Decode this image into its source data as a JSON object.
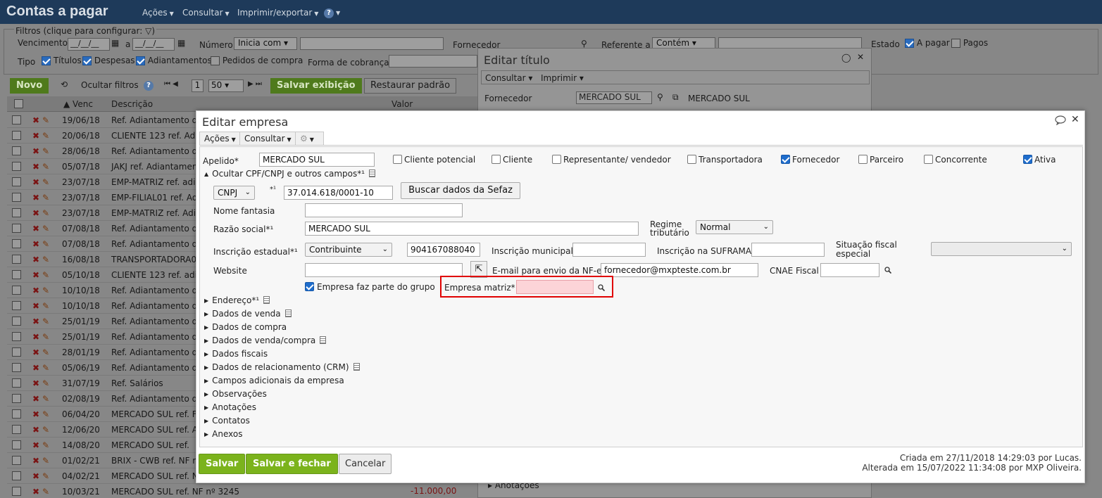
{
  "app": {
    "title": "Contas a pagar",
    "menu": [
      "Ações",
      "Consultar",
      "Imprimir/exportar"
    ]
  },
  "filters": {
    "legend": "Filtros (clique para configurar:",
    "vencimento_label": "Vencimento",
    "date_placeholder": "__/__/__",
    "a_label": "a",
    "numero_label": "Número",
    "numero_mode": "Inicia com",
    "fornecedor_label": "Fornecedor",
    "referente_label": "Referente a",
    "referente_mode": "Contém",
    "estado_label": "Estado",
    "estado_options": [
      {
        "label": "A pagar",
        "checked": true
      },
      {
        "label": "Pagos",
        "checked": false
      }
    ],
    "tipo_label": "Tipo",
    "tipo_options": [
      {
        "label": "Títulos",
        "checked": true
      },
      {
        "label": "Despesas",
        "checked": true
      },
      {
        "label": "Adiantamentos",
        "checked": true
      },
      {
        "label": "Pedidos de compra",
        "checked": false
      }
    ],
    "forma_label": "Forma de cobrança"
  },
  "toolbar": {
    "novo": "Novo",
    "ocultar_filtros": "Ocultar filtros",
    "page": "1",
    "per_page": "50",
    "salvar_exibicao": "Salvar exibição",
    "restaurar_padrao": "Restaurar padrão"
  },
  "grid": {
    "headers": {
      "venc": "Venc",
      "descricao": "Descrição",
      "valor": "Valor"
    },
    "rows": [
      {
        "venc": "19/06/18",
        "desc": "Ref. Adiantamento de"
      },
      {
        "venc": "20/06/18",
        "desc": "CLIENTE 123 ref. Adi"
      },
      {
        "venc": "28/06/18",
        "desc": "Ref. Adiantamento de"
      },
      {
        "venc": "05/07/18",
        "desc": "JAKJ ref. Adiantamen"
      },
      {
        "venc": "23/07/18",
        "desc": "EMP-MATRIZ ref. adia"
      },
      {
        "venc": "23/07/18",
        "desc": "EMP-FILIAL01 ref. Ad"
      },
      {
        "venc": "23/07/18",
        "desc": "EMP-MATRIZ ref. Adi"
      },
      {
        "venc": "07/08/18",
        "desc": "Ref. Adiantamento de"
      },
      {
        "venc": "07/08/18",
        "desc": "Ref. Adiantamento de"
      },
      {
        "venc": "16/08/18",
        "desc": "TRANSPORTADORA0"
      },
      {
        "venc": "05/10/18",
        "desc": "CLIENTE 123 ref. adi"
      },
      {
        "venc": "10/10/18",
        "desc": "Ref. Adiantamento de"
      },
      {
        "venc": "10/10/18",
        "desc": "Ref. Adiantamento de"
      },
      {
        "venc": "25/01/19",
        "desc": "Ref. Adiantamento de"
      },
      {
        "venc": "25/01/19",
        "desc": "Ref. Adiantamento de"
      },
      {
        "venc": "28/01/19",
        "desc": "Ref. Adiantamento de"
      },
      {
        "venc": "05/06/19",
        "desc": "Ref. Adiantamento de"
      },
      {
        "venc": "31/07/19",
        "desc": "Ref. Salários"
      },
      {
        "venc": "02/08/19",
        "desc": "Ref. Adiantamento de"
      },
      {
        "venc": "06/04/20",
        "desc": "MERCADO SUL ref. F"
      },
      {
        "venc": "12/06/20",
        "desc": "MERCADO SUL ref. A"
      },
      {
        "venc": "14/08/20",
        "desc": "MERCADO SUL ref."
      },
      {
        "venc": "01/02/21",
        "desc": "BRIX - CWB ref. NF r"
      },
      {
        "venc": "04/02/21",
        "desc": "MERCADO SUL ref. N"
      },
      {
        "venc": "10/03/21",
        "desc": "MERCADO SUL ref. NF nº 3245"
      }
    ],
    "last_value": "-11.000,00"
  },
  "titulo_dialog": {
    "title": "Editar título",
    "menu": [
      "Consultar",
      "Imprimir"
    ],
    "fornecedor_label": "Fornecedor",
    "fornecedor_value": "MERCADO SUL",
    "fornecedor_link": "MERCADO SUL",
    "anotacoes": "Anotações"
  },
  "dialog": {
    "title": "Editar empresa",
    "menu": [
      "Ações",
      "Consultar"
    ],
    "apelido_label": "Apelido*",
    "apelido_value": "MERCADO SUL",
    "roles": [
      {
        "label": "Cliente potencial",
        "checked": false
      },
      {
        "label": "Cliente",
        "checked": false
      },
      {
        "label": "Representante/ vendedor",
        "checked": false
      },
      {
        "label": "Transportadora",
        "checked": false
      },
      {
        "label": "Fornecedor",
        "checked": true
      },
      {
        "label": "Parceiro",
        "checked": false
      },
      {
        "label": "Concorrente",
        "checked": false
      },
      {
        "label": "Ativa",
        "checked": true
      }
    ],
    "ocultar_label": "Ocultar CPF/CNPJ e outros campos*¹",
    "doc_type": "CNPJ",
    "doc_marker": "*¹",
    "doc_value": "37.014.618/0001-10",
    "sefaz_button": "Buscar dados da Sefaz",
    "nome_fantasia_label": "Nome fantasia",
    "nome_fantasia_value": "",
    "razao_label": "Razão social*¹",
    "razao_value": "MERCADO SUL",
    "regime_label_1": "Regime",
    "regime_label_2": "tributário",
    "regime_value": "Normal",
    "ie_label": "Inscrição estadual*¹",
    "ie_type": "Contribuinte",
    "ie_value": "904167088040",
    "im_label": "Inscrição municipal",
    "suframa_label": "Inscrição na SUFRAMA",
    "situacao_label_1": "Situação fiscal",
    "situacao_label_2": "especial",
    "website_label": "Website",
    "email_label": "E-mail para envio da NF-e",
    "email_value": "fornecedor@mxpteste.com.br",
    "cnae_label": "CNAE Fiscal",
    "grupo_label": "Empresa faz parte do grupo",
    "grupo_checked": true,
    "matriz_label": "Empresa matriz*",
    "matriz_value": "",
    "sections": [
      {
        "label": "Endereço*¹",
        "doc": true
      },
      {
        "label": "Dados de venda",
        "doc": true
      },
      {
        "label": "Dados de compra",
        "doc": false
      },
      {
        "label": "Dados de venda/compra",
        "doc": true
      },
      {
        "label": "Dados fiscais",
        "doc": false
      },
      {
        "label": "Dados de relacionamento (CRM)",
        "doc": true
      },
      {
        "label": "Campos adicionais da empresa",
        "doc": false
      },
      {
        "label": "Observações",
        "doc": false
      },
      {
        "label": "Anotações",
        "doc": false
      },
      {
        "label": "Contatos",
        "doc": false
      },
      {
        "label": "Anexos",
        "doc": false
      }
    ],
    "buttons": {
      "salvar": "Salvar",
      "salvar_fechar": "Salvar e fechar",
      "cancelar": "Cancelar"
    },
    "created": "Criada em 27/11/2018 14:29:03 por Lucas.",
    "modified": "Alterada em 15/07/2022 11:34:08 por MXP Oliveira."
  },
  "colors": {
    "header": "#1e3a5a",
    "green": "#7bb31c",
    "highlight": "#e00000",
    "check": "#1f6dcc"
  }
}
